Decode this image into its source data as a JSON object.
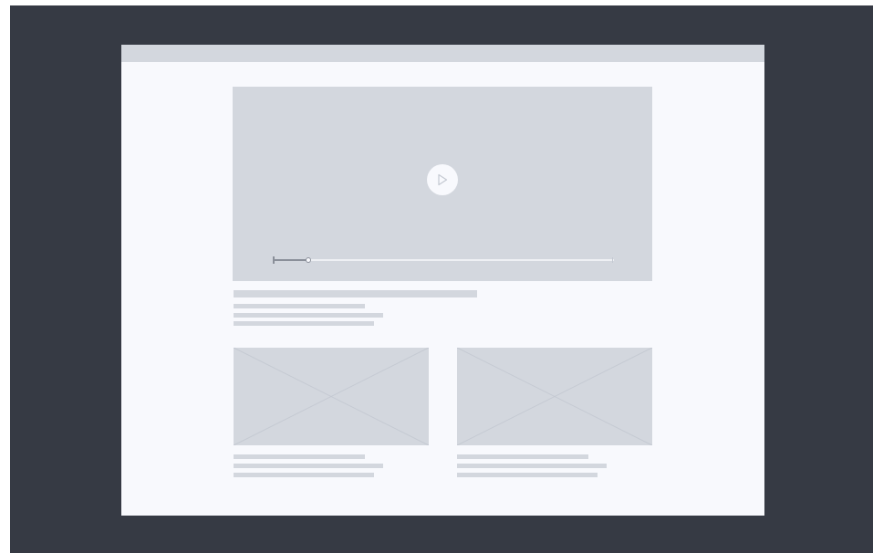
{
  "colors": {
    "backdrop": "#363a44",
    "window_titlebar": "#d3d7de",
    "page_background": "#f8f9fd",
    "placeholder_fill": "#d3d7de",
    "placeholder_line": "#c4c9d2",
    "text_line": "#d3d7de",
    "play_button_bg": "#f8f9fd",
    "play_icon": "#c4c9d2",
    "scrubber_track": "#eef0f4",
    "scrubber_progress": "#8a8f99",
    "scrubber_end": "#c4c9d2"
  },
  "icons": {
    "play": "play-icon",
    "image_placeholder": "image-placeholder-icon"
  },
  "video": {
    "progress": 0.105
  }
}
